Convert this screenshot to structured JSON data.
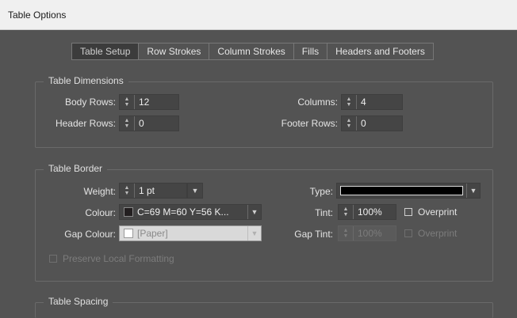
{
  "window": {
    "title": "Table Options"
  },
  "tabs": [
    {
      "label": "Table Setup",
      "active": true
    },
    {
      "label": "Row Strokes"
    },
    {
      "label": "Column Strokes"
    },
    {
      "label": "Fills"
    },
    {
      "label": "Headers and Footers"
    }
  ],
  "dimensions": {
    "legend": "Table Dimensions",
    "body_rows": {
      "label": "Body Rows:",
      "value": "12"
    },
    "columns": {
      "label": "Columns:",
      "value": "4"
    },
    "header_rows": {
      "label": "Header Rows:",
      "value": "0"
    },
    "footer_rows": {
      "label": "Footer Rows:",
      "value": "0"
    }
  },
  "border": {
    "legend": "Table Border",
    "weight": {
      "label": "Weight:",
      "value": "1 pt"
    },
    "type": {
      "label": "Type:",
      "swatch_color": "#000000"
    },
    "colour": {
      "label": "Colour:",
      "value": "C=69 M=60 Y=56 K...",
      "swatch_color": "#231f20"
    },
    "tint": {
      "label": "Tint:",
      "value": "100%"
    },
    "overprint": {
      "label": "Overprint",
      "checked": false
    },
    "gap_colour": {
      "label": "Gap Colour:",
      "value": "[Paper]",
      "swatch_color": "#ffffff"
    },
    "gap_tint": {
      "label": "Gap Tint:",
      "value": "100%"
    },
    "gap_overprint": {
      "label": "Overprint",
      "checked": false
    },
    "preserve": {
      "label": "Preserve Local Formatting",
      "checked": false
    }
  },
  "spacing": {
    "legend": "Table Spacing"
  }
}
